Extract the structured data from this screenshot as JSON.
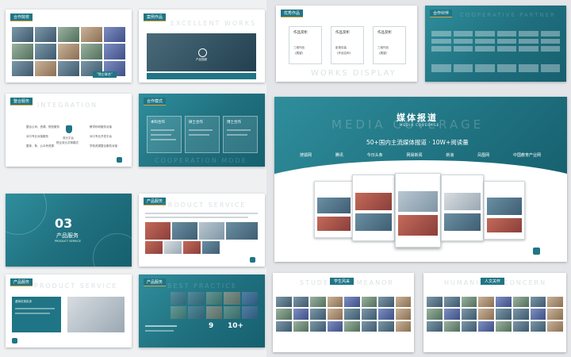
{
  "slides": {
    "s1": {
      "tag": "合作院校",
      "note": "\"院企联合\""
    },
    "s2": {
      "tag": "案例作品",
      "ghost": "EXCELLENT WORKS",
      "caption": "产品视频"
    },
    "s3": {
      "tag": "整合服务",
      "ghost": "INTEGRATION",
      "left": [
        "整合公司、资源、院校服务",
        "对口专业对接服务",
        "整体、条、公众号资源"
      ],
      "center": [
        "双元平台",
        "院企双元共育模式"
      ],
      "right": [
        "教学科研服务对接",
        "对口专业开发平台",
        "学校资源整合服务对接"
      ]
    },
    "s4": {
      "tag": "合作模式",
      "ghost": "COOPERATION MODE",
      "cards": [
        "本科合作",
        "硕士合作",
        "博士合作"
      ]
    },
    "s5": {
      "ghost": "PRODUCT SERVICE",
      "num": "03",
      "title": "产品服务",
      "sub": "PRODUCT SERVICE"
    },
    "s6": {
      "tag": "产品服务",
      "ghost": "PRODUCT SERVICE"
    },
    "s7": {
      "tag": "产品服务",
      "ghost": "PRODUCT SERVICE",
      "box": "虚拟仿真实训"
    },
    "s8": {
      "tag": "产品服务",
      "ghost": "BEST PRACTICE",
      "stat1": "9",
      "stat2": "10+"
    },
    "s9": {
      "tag": "优秀作品",
      "ghost": "WORKS DISPLAY",
      "cards": [
        {
          "title": "作品赏析",
          "l1": "三维作品",
          "l2": "《展望》"
        },
        {
          "title": "作品赏析",
          "l1": "影视包装",
          "l2": "《作品名称》"
        },
        {
          "title": "作品赏析",
          "l1": "三维作品",
          "l2": "《展望》"
        }
      ]
    },
    "s10": {
      "tag": "合作伙伴",
      "ghost": "COOPERATIVE PARTNER"
    },
    "s11": {
      "title": "媒体报道",
      "sub": "MEDIA COVERAGE",
      "ghost": "MEDIA COVERAGE",
      "stat": "50+国内主流媒体报道 · 10W+阅读量",
      "media": [
        "搜狐网",
        "腾讯",
        "今日头条",
        "网易新闻",
        "新浪",
        "凤凰网",
        "中国教育产业网"
      ]
    },
    "s12": {
      "tag": "学生风采",
      "ghost": "STUDENT DEMEANOR"
    },
    "s13": {
      "tag": "人文关怀",
      "ghost": "HUMANISTIC CONCERN"
    }
  },
  "colors": {
    "teal": "#1f7585",
    "gold": "#d9a441",
    "accent": "#f0a23b"
  }
}
